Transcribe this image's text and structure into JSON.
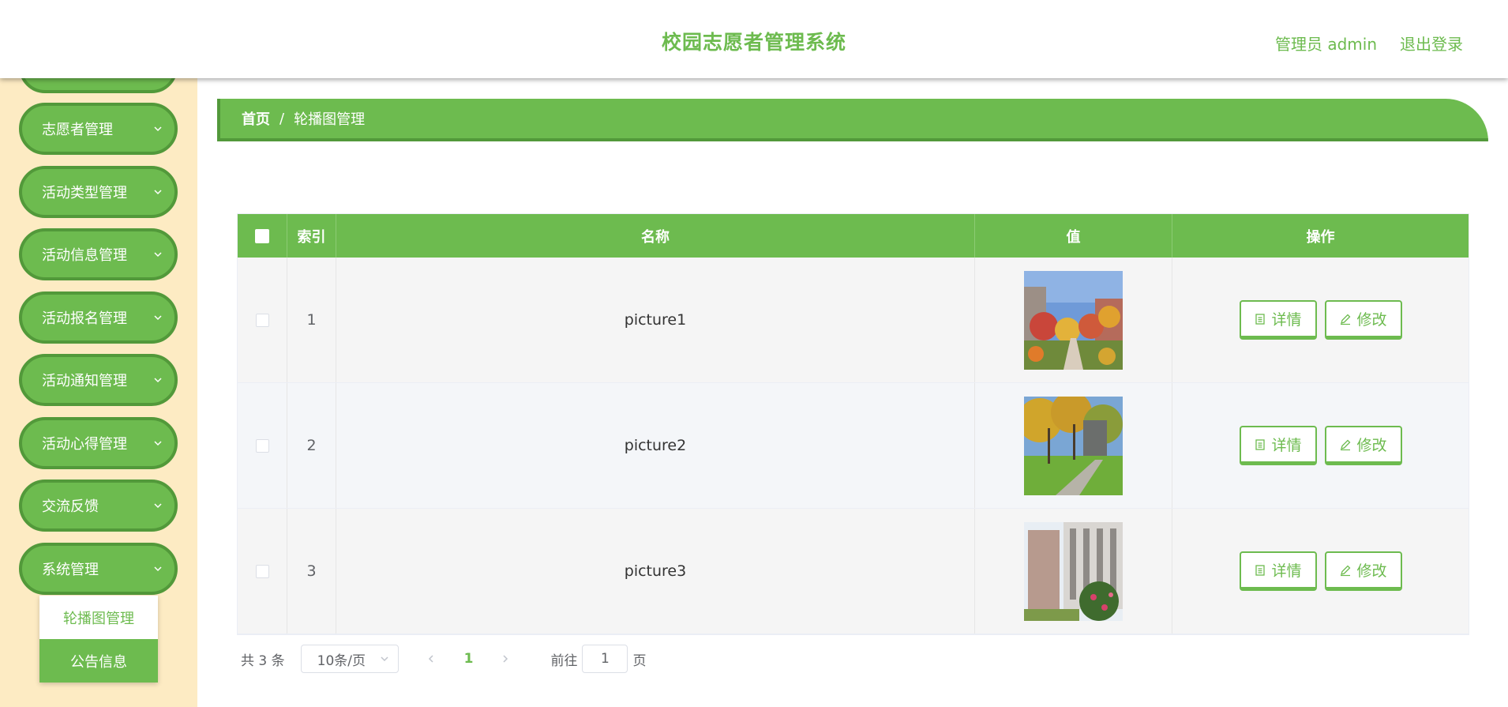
{
  "header": {
    "title": "校园志愿者管理系统",
    "user": "管理员 admin",
    "logout": "退出登录"
  },
  "sidebar": {
    "items": [
      {
        "label": ""
      },
      {
        "label": "志愿者管理"
      },
      {
        "label": "活动类型管理"
      },
      {
        "label": "活动信息管理"
      },
      {
        "label": "活动报名管理"
      },
      {
        "label": "活动通知管理"
      },
      {
        "label": "活动心得管理"
      },
      {
        "label": "交流反馈"
      },
      {
        "label": "系统管理"
      }
    ],
    "submenu": [
      {
        "label": "轮播图管理"
      },
      {
        "label": "公告信息"
      }
    ]
  },
  "breadcrumb": {
    "home": "首页",
    "sep": "/",
    "current": "轮播图管理"
  },
  "table": {
    "headers": {
      "index": "索引",
      "name": "名称",
      "value": "值",
      "actions": "操作"
    },
    "rows": [
      {
        "index": "1",
        "name": "picture1",
        "detail": "详情",
        "edit": "修改",
        "image": "campus-autumn-path"
      },
      {
        "index": "2",
        "name": "picture2",
        "detail": "详情",
        "edit": "修改",
        "image": "campus-trees-lawn"
      },
      {
        "index": "3",
        "name": "picture3",
        "detail": "详情",
        "edit": "修改",
        "image": "campus-building-flowers"
      }
    ]
  },
  "pagination": {
    "total": "共 3 条",
    "page_size": "10条/页",
    "current_page": "1",
    "goto_prefix": "前往",
    "goto_value": "1",
    "goto_suffix": "页"
  },
  "colors": {
    "accent": "#6dbb4f",
    "accent_dark": "#52993a",
    "sidebar_bg": "#fdebc3"
  }
}
